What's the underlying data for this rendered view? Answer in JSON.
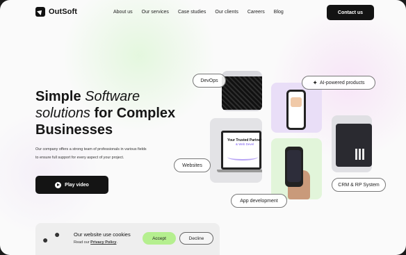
{
  "header": {
    "brand": "OutSoft",
    "nav": [
      "About us",
      "Our services",
      "Case studies",
      "Our clients",
      "Careers",
      "Blog"
    ],
    "cta": "Contact us"
  },
  "hero": {
    "title_line1_plain": "Simple ",
    "title_line1_italic": "Software",
    "title_line2_italic": "solutions",
    "title_line2_plain": " for Complex",
    "title_line3": "Businesses",
    "description": "Our company offers a strong team of professionals in various fields to ensure full support for every aspect of your project.",
    "play_label": "Play video"
  },
  "services": {
    "devops": "DevOps",
    "ai": "AI-powered products",
    "websites": "Websites",
    "crm": "CRM & RP System",
    "app": "App development",
    "laptop_title": "Your Trusted Partner",
    "laptop_subtitle": "& Web Devel"
  },
  "cookie": {
    "title": "Our website use cookies",
    "subtitle_prefix": "Read our ",
    "policy_link": "Privacy Policy",
    "subtitle_suffix": ".",
    "accept": "Accept",
    "decline": "Decline"
  },
  "colors": {
    "accent_green": "#b5ef8f",
    "dark": "#131313"
  }
}
